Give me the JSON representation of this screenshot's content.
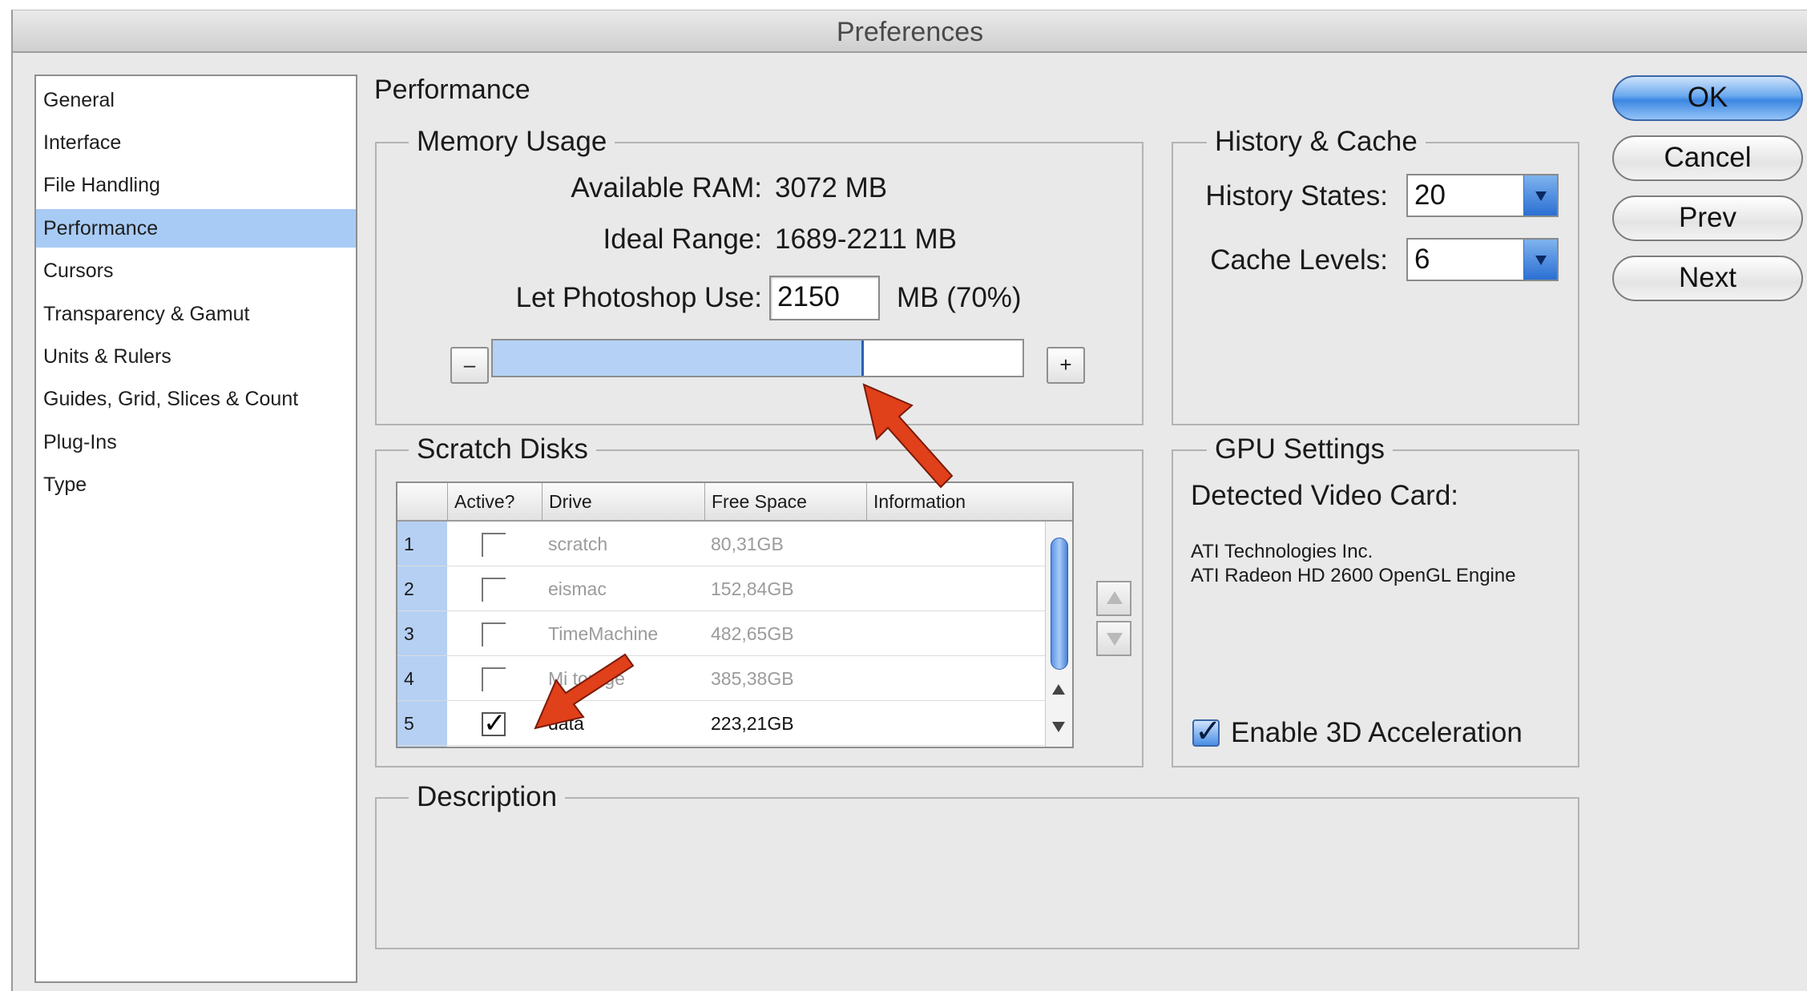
{
  "window": {
    "title": "Preferences"
  },
  "sidebar": {
    "items": [
      {
        "label": "General",
        "selected": false
      },
      {
        "label": "Interface",
        "selected": false
      },
      {
        "label": "File Handling",
        "selected": false
      },
      {
        "label": "Performance",
        "selected": true
      },
      {
        "label": "Cursors",
        "selected": false
      },
      {
        "label": "Transparency & Gamut",
        "selected": false
      },
      {
        "label": "Units & Rulers",
        "selected": false
      },
      {
        "label": "Guides, Grid, Slices & Count",
        "selected": false
      },
      {
        "label": "Plug-Ins",
        "selected": false
      },
      {
        "label": "Type",
        "selected": false
      }
    ]
  },
  "main": {
    "heading": "Performance"
  },
  "memory": {
    "legend": "Memory Usage",
    "available_label": "Available RAM:",
    "available_value": "3072 MB",
    "ideal_label": "Ideal Range:",
    "ideal_value": "1689-2211 MB",
    "use_label": "Let Photoshop Use:",
    "use_value": "2150",
    "use_unit": "MB (70%)",
    "minus": "–",
    "plus": "+",
    "slider_fraction": 0.7
  },
  "history": {
    "legend": "History & Cache",
    "states_label": "History States:",
    "states_value": "20",
    "cache_label": "Cache Levels:",
    "cache_value": "6"
  },
  "scratch": {
    "legend": "Scratch Disks",
    "columns": [
      "Active?",
      "Drive",
      "Free Space",
      "Information"
    ],
    "rows": [
      {
        "num": "1",
        "active": false,
        "drive": "scratch",
        "free": "80,31GB"
      },
      {
        "num": "2",
        "active": false,
        "drive": "eismac",
        "free": "152,84GB"
      },
      {
        "num": "3",
        "active": false,
        "drive": "TimeMachine",
        "free": "482,65GB"
      },
      {
        "num": "4",
        "active": false,
        "drive": "Mi  torage",
        "free": "385,38GB"
      },
      {
        "num": "5",
        "active": true,
        "drive": "data",
        "free": "223,21GB"
      }
    ]
  },
  "gpu": {
    "legend": "GPU Settings",
    "detected_label": "Detected Video Card:",
    "vendor": "ATI Technologies Inc.",
    "engine": "ATI Radeon HD 2600 OpenGL Engine",
    "accel_label": "Enable 3D Acceleration",
    "accel_checked": true
  },
  "description": {
    "legend": "Description"
  },
  "buttons": {
    "ok": "OK",
    "cancel": "Cancel",
    "prev": "Prev",
    "next": "Next"
  },
  "colors": {
    "selection": "#a8cbf5",
    "slider_fill": "#b5d2f6",
    "arrow": "#e0401a"
  }
}
